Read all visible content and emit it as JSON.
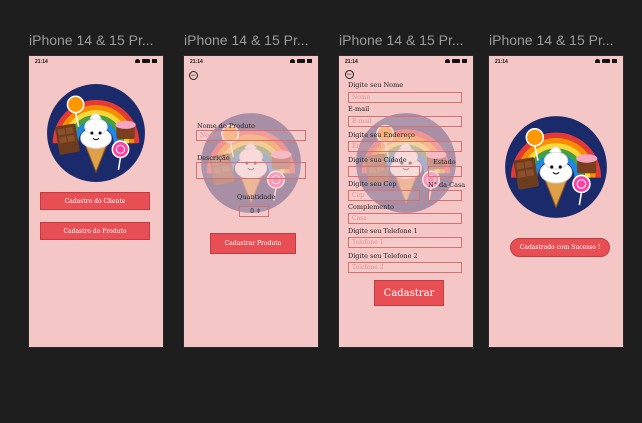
{
  "frames": [
    {
      "title": "iPhone 14 & 15 Pr..."
    },
    {
      "title": "iPhone 14 & 15 Pr..."
    },
    {
      "title": "iPhone 14 & 15 Pr..."
    },
    {
      "title": "iPhone 14 & 15 Pr..."
    }
  ],
  "status": {
    "time": "21:14"
  },
  "screen1": {
    "btn_cliente": "Cadastro do Cliente",
    "btn_produto": "Cadastro do Produto"
  },
  "screen2": {
    "nome_label": "Nome do Produto",
    "nome_placeholder": "Nome",
    "descricao_label": "Descrição",
    "quantidade_label": "Quantidade",
    "quantidade_value": "0",
    "btn_cadastrar": "Cadastrar Produto"
  },
  "screen3": {
    "nome_label": "Digite seu Nome",
    "nome_placeholder": "Nome",
    "email_label": "E-mail",
    "email_placeholder": "E-mail",
    "endereco_label": "Digite seu Endereço",
    "endereco_placeholder": "Endereço",
    "cidade_label": "Digite sua Cidade",
    "estado_label": "Estado",
    "cep_label": "Digite seu Cep",
    "numero_label": "N° da Casa",
    "cep_placeholder": "Cep",
    "complemento_label": "Complemento",
    "complemento_placeholder": "Casa",
    "tel1_label": "Digite seu Telefone 1",
    "tel1_placeholder": "Telefone 1",
    "tel2_label": "Digite seu Telefone 2",
    "tel2_placeholder": "Telefone 2",
    "btn_cadastrar": "Cadastrar"
  },
  "screen4": {
    "success": "Cadastrado com Sucesso !"
  },
  "colors": {
    "background": "#1e1e1e",
    "screen": "#f5c6c6",
    "button": "#e84f55",
    "input_border": "#d7706f"
  }
}
